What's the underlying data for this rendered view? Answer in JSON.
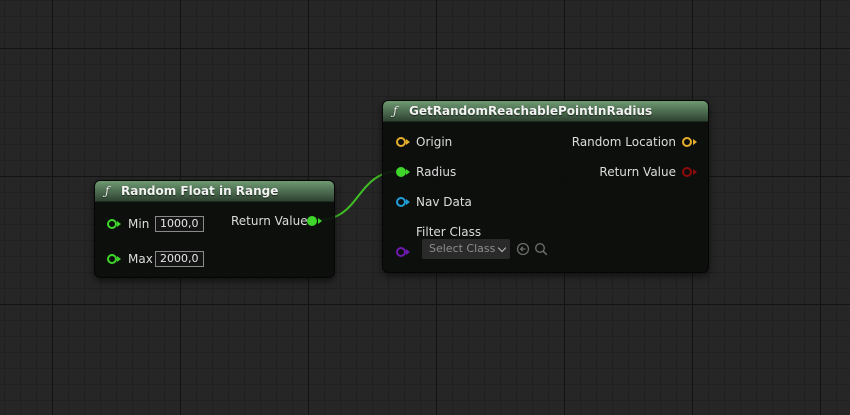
{
  "nodes": {
    "random_float": {
      "title": "Random Float in Range",
      "icon": "function-icon",
      "inputs": [
        {
          "label": "Min",
          "value": "1000,0"
        },
        {
          "label": "Max",
          "value": "2000,0"
        }
      ],
      "output": {
        "label": "Return Value"
      }
    },
    "reachable_point": {
      "title": "GetRandomReachablePointInRadius",
      "icon": "function-icon",
      "inputs": [
        {
          "label": "Origin"
        },
        {
          "label": "Radius"
        },
        {
          "label": "Nav Data"
        },
        {
          "label": "Filter Class",
          "placeholder": "Select Class"
        }
      ],
      "outputs": [
        {
          "label": "Random Location"
        },
        {
          "label": "Return Value"
        }
      ]
    }
  },
  "colors": {
    "float_pin": "#3ed62a",
    "vector_pin": "#e5ae2b",
    "object_pin": "#1e9fd8",
    "class_pin": "#6e1ab0",
    "bool_pin": "#8c0b0b",
    "wire": "#3fbf24"
  }
}
